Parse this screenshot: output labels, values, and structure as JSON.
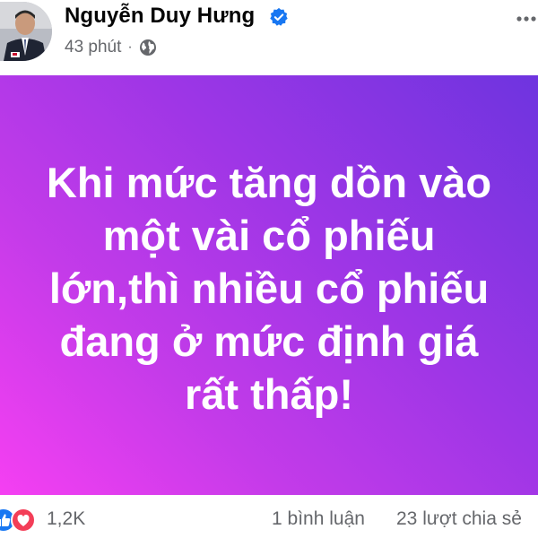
{
  "post": {
    "author": "Nguyễn Duy Hưng",
    "verified": true,
    "time": "43 phút",
    "separator": "·",
    "audience_icon": "globe-icon",
    "more_icon": "more-horizontal-icon"
  },
  "banner": {
    "lines": [
      "Khi mức tăng dồn vào",
      "một vài cổ phiếu",
      "lớn,thì nhiều cổ phiếu",
      "đang ở mức định giá",
      "rất thấp!"
    ],
    "gradient_colors": [
      "#f53ff2",
      "#c43be9",
      "#9e36e6",
      "#6e34df"
    ],
    "text_color": "#ffffff"
  },
  "footer": {
    "reaction_icons": [
      "like-icon",
      "love-icon"
    ],
    "reaction_count": "1,2K",
    "comments": "1 bình luận",
    "shares": "23 lượt chia sẻ"
  },
  "colors": {
    "name": "#050505",
    "meta": "#65676b",
    "verified": "#1877f2",
    "like": "#1877f2",
    "love": "#f33e58"
  }
}
